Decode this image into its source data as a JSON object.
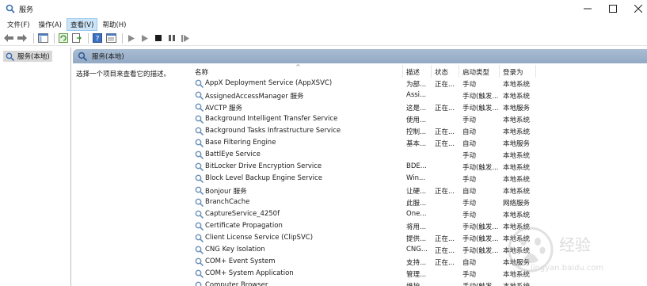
{
  "window": {
    "title": "服务"
  },
  "menu": [
    {
      "label": "文件(F)"
    },
    {
      "label": "操作(A)"
    },
    {
      "label": "查看(V)"
    },
    {
      "label": "帮助(H)"
    }
  ],
  "left_pane": {
    "tree_item": "服务(本地)"
  },
  "main": {
    "header": "服务(本地)",
    "description_prompt": "选择一个项目来查看它的描述。"
  },
  "columns": [
    "名称",
    "描述",
    "状态",
    "启动类型",
    "登录为"
  ],
  "services": [
    {
      "name": "AppX Deployment Service (AppXSVC)",
      "desc": "为部...",
      "status": "正在...",
      "start": "手动",
      "logon": "本地系统"
    },
    {
      "name": "AssignedAccessManager 服务",
      "desc": "Assi...",
      "status": "",
      "start": "手动(触发...",
      "logon": "本地系统"
    },
    {
      "name": "AVCTP 服务",
      "desc": "这是...",
      "status": "正在...",
      "start": "手动(触发...",
      "logon": "本地服务"
    },
    {
      "name": "Background Intelligent Transfer Service",
      "desc": "使用...",
      "status": "",
      "start": "手动",
      "logon": "本地系统"
    },
    {
      "name": "Background Tasks Infrastructure Service",
      "desc": "控制...",
      "status": "正在...",
      "start": "自动",
      "logon": "本地系统"
    },
    {
      "name": "Base Filtering Engine",
      "desc": "基本...",
      "status": "正在...",
      "start": "自动",
      "logon": "本地服务"
    },
    {
      "name": "BattlEye Service",
      "desc": "",
      "status": "",
      "start": "手动",
      "logon": "本地系统"
    },
    {
      "name": "BitLocker Drive Encryption Service",
      "desc": "BDE...",
      "status": "",
      "start": "手动(触发...",
      "logon": "本地系统"
    },
    {
      "name": "Block Level Backup Engine Service",
      "desc": "Win...",
      "status": "",
      "start": "手动",
      "logon": "本地系统"
    },
    {
      "name": "Bonjour 服务",
      "desc": "让硬...",
      "status": "正在...",
      "start": "自动",
      "logon": "本地系统"
    },
    {
      "name": "BranchCache",
      "desc": "此服...",
      "status": "",
      "start": "手动",
      "logon": "网络服务"
    },
    {
      "name": "CaptureService_4250f",
      "desc": "One...",
      "status": "",
      "start": "手动",
      "logon": "本地系统"
    },
    {
      "name": "Certificate Propagation",
      "desc": "将用...",
      "status": "",
      "start": "手动(触发...",
      "logon": "本地系统"
    },
    {
      "name": "Client License Service (ClipSVC)",
      "desc": "提供...",
      "status": "正在...",
      "start": "手动(触发...",
      "logon": "本地系统"
    },
    {
      "name": "CNG Key Isolation",
      "desc": "CNG...",
      "status": "正在...",
      "start": "手动(触发...",
      "logon": "本地系统"
    },
    {
      "name": "COM+ Event System",
      "desc": "支持...",
      "status": "正在...",
      "start": "自动",
      "logon": "本地服务"
    },
    {
      "name": "COM+ System Application",
      "desc": "管理...",
      "status": "",
      "start": "手动",
      "logon": "本地系统"
    },
    {
      "name": "Computer Browser",
      "desc": "维护...",
      "status": "",
      "start": "手动(触发...",
      "logon": "本地系统"
    }
  ],
  "watermark": {
    "text": "经验",
    "url": "jingyan.baidu.com"
  }
}
